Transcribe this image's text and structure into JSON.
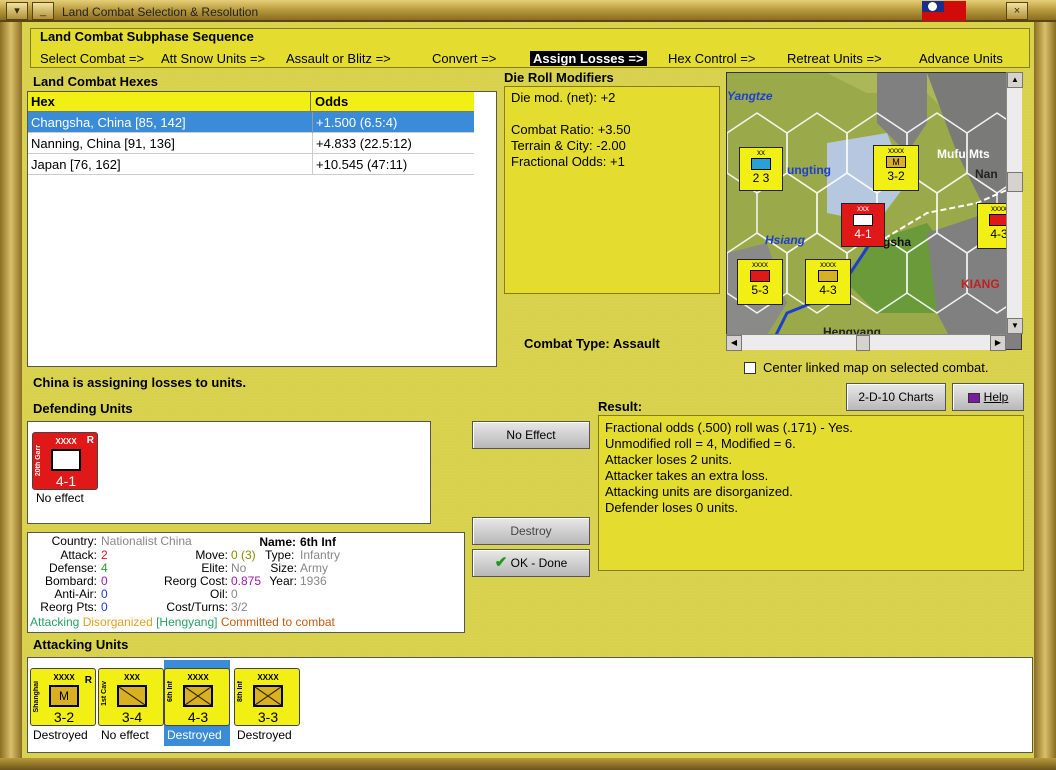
{
  "window": {
    "title": "Land Combat Selection & Resolution"
  },
  "sequence": {
    "title": "Land Combat Subphase Sequence",
    "steps": [
      "Select Combat =>",
      "Att Snow Units =>",
      "Assault or Blitz =>",
      "Convert =>",
      "Assign Losses =>",
      "Hex Control =>",
      "Retreat Units =>",
      "Advance Units"
    ],
    "active_step": "Assign Losses =>"
  },
  "hexes": {
    "title": "Land Combat Hexes",
    "columns": [
      "Hex",
      "Odds"
    ],
    "rows": [
      {
        "hex": "Changsha, China [85, 142]",
        "odds": "+1.500 (6.5:4)",
        "selected": true
      },
      {
        "hex": "Nanning, China [91, 136]",
        "odds": "+4.833 (22.5:12)",
        "selected": false
      },
      {
        "hex": "Japan [76, 162]",
        "odds": "+10.545 (47:11)",
        "selected": false
      }
    ]
  },
  "modifiers": {
    "title": "Die Roll Modifiers",
    "lines": [
      "Die mod. (net): +2",
      "",
      "Combat Ratio: +3.50",
      "Terrain & City: -2.00",
      "Fractional Odds: +1"
    ]
  },
  "combat_type": {
    "label": "Combat Type:",
    "value": "Assault"
  },
  "map": {
    "labels": [
      "Yangtze",
      "Mufu Mts",
      "Nan",
      "ungting",
      "Hsiang",
      "gsha",
      "KIANG",
      "Hengyang"
    ],
    "counters": [
      {
        "name": "2d Inf",
        "size": "xx",
        "strength": "2 3",
        "color": "#f2ef14"
      },
      {
        "name": "Shanghai",
        "size": "xxxx",
        "strength": "3-2",
        "color": "#f2ef14"
      },
      {
        "name": "20th Gar",
        "size": "xxx",
        "strength": "4-1",
        "color": "#e01818"
      },
      {
        "name": "3rd Inf",
        "size": "xxxx",
        "strength": "4-3",
        "color": "#f2ef14"
      },
      {
        "name": "5th Inf",
        "size": "xxxx",
        "strength": "5-3",
        "color": "#f2ef14"
      },
      {
        "name": "6th Inf",
        "size": "xxxx",
        "strength": "4-3",
        "color": "#f2ef14"
      }
    ]
  },
  "center_map": {
    "label": "Center linked map on selected combat.",
    "checked": false
  },
  "buttons": {
    "charts": "2-D-10 Charts",
    "help": "Help",
    "no_effect": "No Effect",
    "destroy": "Destroy",
    "ok_done": "OK - Done"
  },
  "status": {
    "assigning": "China is assigning losses to units."
  },
  "defending": {
    "title": "Defending Units",
    "units": [
      {
        "name": "20th Garr",
        "size": "XXXX",
        "flag": "R",
        "strength": "4-1",
        "result": "No effect",
        "color": "#e01818"
      }
    ]
  },
  "result": {
    "title": "Result:",
    "lines": [
      "Fractional odds (.500) roll was (.171)  - Yes.",
      "Unmodified roll = 4, Modified = 6.",
      "Attacker loses 2 units.",
      "Attacker takes an extra loss.",
      "Attacking units are disorganized.",
      "Defender loses 0 units."
    ]
  },
  "unit_info": {
    "country_label": "Country:",
    "country": "Nationalist China",
    "name_label": "Name:",
    "name": "6th Inf",
    "attack_label": "Attack:",
    "attack": "2",
    "defense_label": "Defense:",
    "defense": "4",
    "bombard_label": "Bombard:",
    "bombard": "0",
    "antiair_label": "Anti-Air:",
    "antiair": "0",
    "reorg_pts_label": "Reorg Pts:",
    "reorg_pts": "0",
    "move_label": "Move:",
    "move": "0 (3)",
    "elite_label": "Elite:",
    "elite": "No",
    "reorg_cost_label": "Reorg Cost:",
    "reorg_cost": "0.875",
    "oil_label": "Oil:",
    "oil": "0",
    "cost_label": "Cost/Turns:",
    "cost": "3/2",
    "type_label": "Type:",
    "type": "Infantry",
    "size_label": "Size:",
    "size": "Army",
    "year_label": "Year:",
    "year": "1936",
    "status_attacking": "Attacking",
    "status_disorganized": "Disorganized",
    "status_location": "[Hengyang]",
    "status_committed": "Committed to combat"
  },
  "attacking": {
    "title": "Attacking Units",
    "units": [
      {
        "name": "Shanghai",
        "size": "XXXX",
        "flag": "R",
        "strength": "3-2",
        "result": "Destroyed",
        "selected": false
      },
      {
        "name": "1st Cav",
        "size": "XXX",
        "flag": "",
        "strength": "3-4",
        "result": "No effect",
        "selected": false
      },
      {
        "name": "6th Inf",
        "size": "XXXX",
        "flag": "",
        "strength": "4-3",
        "result": "Destroyed",
        "selected": true
      },
      {
        "name": "8th Inf",
        "size": "XXXX",
        "flag": "",
        "strength": "3-3",
        "result": "Destroyed",
        "selected": false
      }
    ]
  },
  "colors": {
    "panel": "#d8d14a",
    "highlight": "#3a8cd8",
    "attack": "#e01818",
    "defense": "#2a9a2a",
    "purple": "#9a1ab0"
  }
}
